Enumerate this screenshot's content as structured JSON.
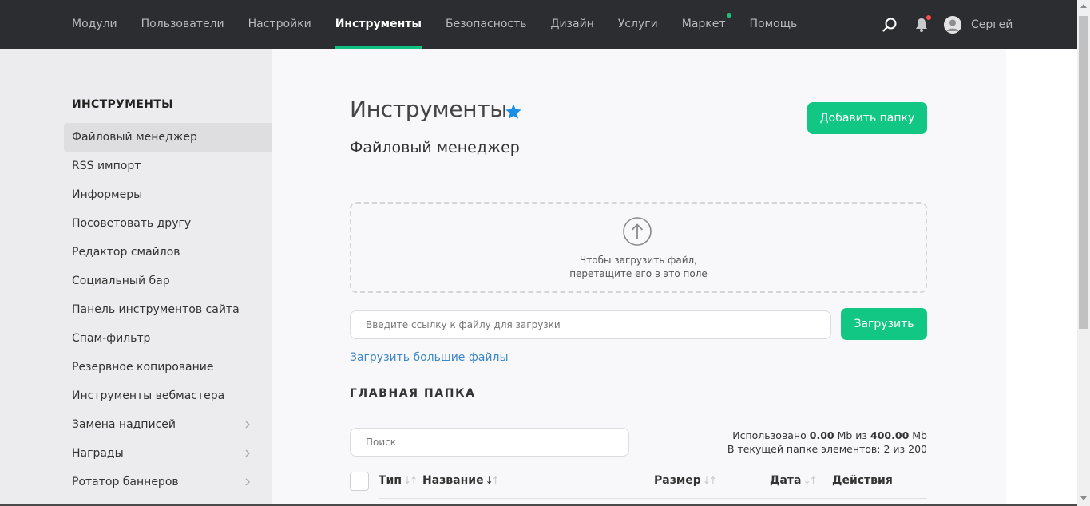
{
  "nav": {
    "items": [
      {
        "label": "Модули"
      },
      {
        "label": "Пользователи"
      },
      {
        "label": "Настройки"
      },
      {
        "label": "Инструменты"
      },
      {
        "label": "Безопасность"
      },
      {
        "label": "Дизайн"
      },
      {
        "label": "Услуги"
      },
      {
        "label": "Маркет"
      },
      {
        "label": "Помощь"
      }
    ],
    "active": "Инструменты",
    "user_name": "Сергей",
    "accent_color": "#10c281",
    "notif_color": "#ff4d4d"
  },
  "sidebar": {
    "title": "ИНСТРУМЕНТЫ",
    "items": [
      {
        "label": "Файловый менеджер"
      },
      {
        "label": "RSS импорт"
      },
      {
        "label": "Информеры"
      },
      {
        "label": "Посоветовать другу"
      },
      {
        "label": "Редактор смайлов"
      },
      {
        "label": "Социальный бар"
      },
      {
        "label": "Панель инструментов сайта"
      },
      {
        "label": "Спам-фильтр"
      },
      {
        "label": "Резервное копирование"
      },
      {
        "label": "Инструменты вебмастера"
      },
      {
        "label": "Замена надписей"
      },
      {
        "label": "Награды"
      },
      {
        "label": "Ротатор баннеров"
      }
    ]
  },
  "main": {
    "title": "Инструменты",
    "subtitle": "Файловый менеджер",
    "add_folder_label": "Добавить папку",
    "dropzone_line1": "Чтобы загрузить файл,",
    "dropzone_line2": "перетащите его в это поле",
    "url_placeholder": "Введите ссылку к файлу для загрузки",
    "upload_label": "Загрузить",
    "big_files_link": "Загрузить большие файлы",
    "section_title": "ГЛАВНАЯ ПАПКА",
    "search_placeholder": "Поиск",
    "usage_prefix": "Использовано",
    "usage_used": "0.00",
    "usage_unit1": "Mb из",
    "usage_total": "400.00",
    "usage_unit2": "Mb",
    "usage_line2": "В текущей папке элементов: 2 из 200",
    "columns": {
      "type": "Тип",
      "name": "Название",
      "size": "Размер",
      "date": "Дата",
      "actions": "Действия"
    },
    "button_color": "#11c783",
    "link_color": "#3b87c9",
    "star_color": "#1a8fe6"
  }
}
